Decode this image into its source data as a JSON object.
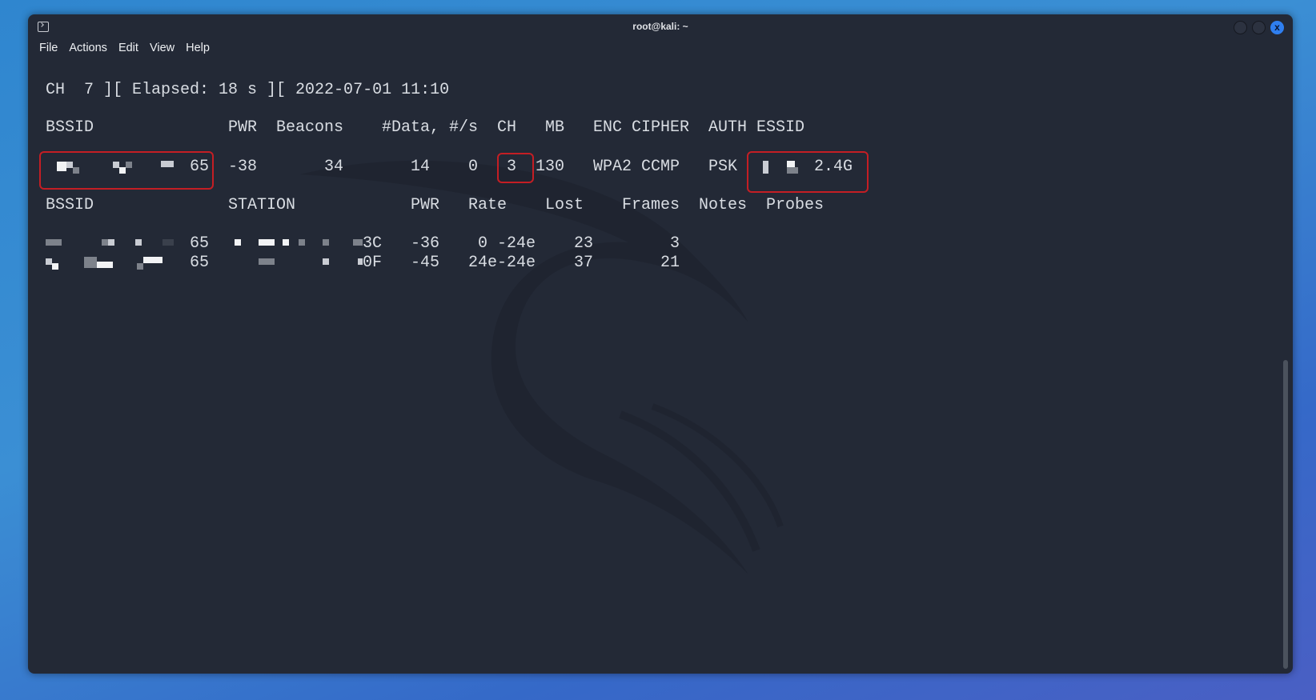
{
  "window": {
    "title": "root@kali: ~",
    "close_label": "x"
  },
  "menu": [
    "File",
    "Actions",
    "Edit",
    "View",
    "Help"
  ],
  "status_line": "CH  7 ][ Elapsed: 18 s ][ 2022-07-01 11:10",
  "ap_table": {
    "headers": [
      "BSSID",
      "PWR",
      "Beacons",
      "#Data,",
      "#/s",
      "CH",
      "MB",
      "ENC",
      "CIPHER",
      "AUTH",
      "ESSID"
    ],
    "row": {
      "bssid_suffix": "65",
      "pwr": "-38",
      "beacons": "34",
      "data": "14",
      "per_s": "0",
      "ch": "3",
      "mb": "130",
      "enc": "WPA2",
      "cipher": "CCMP",
      "auth": "PSK",
      "essid_suffix": "2.4G"
    }
  },
  "station_table": {
    "headers": [
      "BSSID",
      "STATION",
      "PWR",
      "Rate",
      "Lost",
      "Frames",
      "Notes",
      "Probes"
    ],
    "rows": [
      {
        "bssid_suffix": "65",
        "station_suffix": "3C",
        "pwr": "-36",
        "rate": "0 -24e",
        "lost": "23",
        "frames": "3"
      },
      {
        "bssid_suffix": "65",
        "station_suffix": "0F",
        "pwr": "-45",
        "rate": "24e-24e",
        "lost": "37",
        "frames": "21"
      }
    ]
  },
  "colors": {
    "highlight": "#c41e24",
    "terminal_bg": "#232936"
  }
}
